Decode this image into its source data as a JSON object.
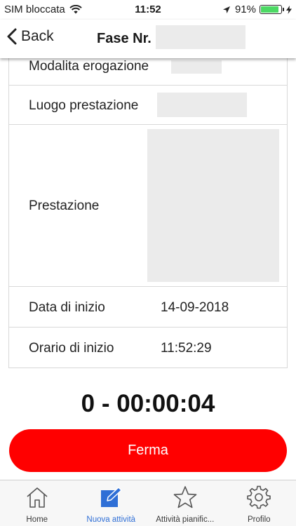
{
  "status_bar": {
    "carrier": "SIM bloccata",
    "time": "11:52",
    "battery_text": "91%",
    "battery_level": 0.91
  },
  "nav": {
    "back_label": "Back",
    "title": "Fase Nr."
  },
  "form": {
    "modalita_label": "Modalita erogazione",
    "luogo_label": "Luogo prestazione",
    "prestazione_label": "Prestazione",
    "data_label": "Data di inizio",
    "data_value": "14-09-2018",
    "orario_label": "Orario di inizio",
    "orario_value": "11:52:29"
  },
  "timer": "0 - 00:00:04",
  "stop_button": {
    "label": "Ferma",
    "color": "#ff0000"
  },
  "tabs": [
    {
      "label": "Home",
      "icon": "home-icon",
      "active": false
    },
    {
      "label": "Nuova attività",
      "icon": "edit-icon",
      "active": true
    },
    {
      "label": "Attività pianific...",
      "icon": "star-icon",
      "active": false
    },
    {
      "label": "Profilo",
      "icon": "gear-icon",
      "active": false
    }
  ],
  "colors": {
    "accent": "#2f6fd6",
    "battery": "#4cd964"
  }
}
